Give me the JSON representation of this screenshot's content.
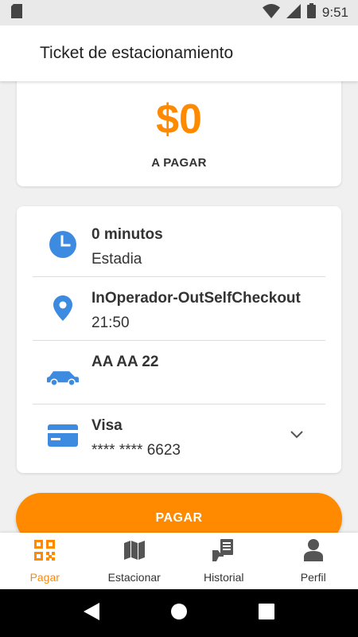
{
  "status_bar": {
    "time": "9:51",
    "icons": [
      "sd-card-icon",
      "wifi-icon",
      "signal-icon",
      "battery-icon"
    ]
  },
  "app_bar": {
    "title": "Ticket de estacionamiento"
  },
  "amount": {
    "value": "$0",
    "label": "A PAGAR"
  },
  "details": {
    "duration": {
      "icon": "clock-icon",
      "value": "0 minutos",
      "label": "Estadia"
    },
    "location": {
      "icon": "location-pin-icon",
      "value": "InOperador-OutSelfCheckout",
      "time": "21:50"
    },
    "vehicle": {
      "icon": "car-icon",
      "plate": "AA AA 22"
    },
    "payment": {
      "icon": "credit-card-icon",
      "brand": "Visa",
      "masked_number": "**** **** 6623"
    }
  },
  "pay_button": {
    "label": "PAGAR"
  },
  "bottom_nav": {
    "items": [
      {
        "label": "Pagar",
        "icon": "qr-code-icon",
        "active": true
      },
      {
        "label": "Estacionar",
        "icon": "map-icon",
        "active": false
      },
      {
        "label": "Historial",
        "icon": "history-receipt-icon",
        "active": false
      },
      {
        "label": "Perfil",
        "icon": "user-icon",
        "active": false
      }
    ]
  },
  "colors": {
    "accent": "#ff8a00",
    "icon_blue": "#3d8be0",
    "text": "#333333"
  }
}
